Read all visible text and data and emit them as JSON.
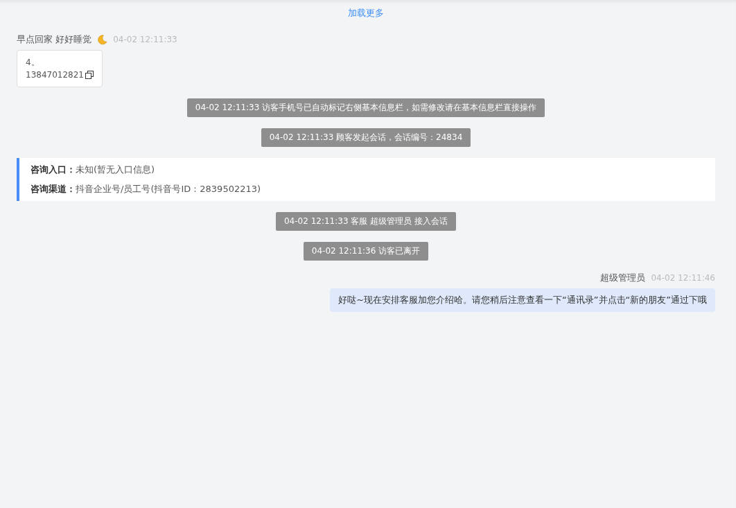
{
  "load_more": "加载更多",
  "messages": [
    {
      "kind": "visitor",
      "sender": "早点回家 好好睡觉",
      "time": "04-02 12:11:33",
      "lines": [
        "4。",
        "13847012821"
      ]
    },
    {
      "kind": "system",
      "text": "04-02 12:11:33 访客手机号已自动标记右侧基本信息栏，如需修改请在基本信息栏直接操作"
    },
    {
      "kind": "system",
      "text": "04-02 12:11:33 顾客发起会话，会话编号：24834"
    },
    {
      "kind": "info",
      "rows": [
        {
          "label": "咨询入口：",
          "value": "未知(暂无入口信息)"
        },
        {
          "label": "咨询渠道：",
          "value": "抖音企业号/员工号(抖音号ID：2839502213)"
        }
      ]
    },
    {
      "kind": "system",
      "text": "04-02 12:11:33 客服 超级管理员 接入会话"
    },
    {
      "kind": "system",
      "text": "04-02 12:11:36 访客已离开"
    },
    {
      "kind": "agent",
      "sender": "超级管理员",
      "time": "04-02 12:11:46",
      "text": "好哒~现在安排客服加您介绍哈。请您稍后注意查看一下“通讯录”并点击“新的朋友”通过下哦"
    }
  ]
}
